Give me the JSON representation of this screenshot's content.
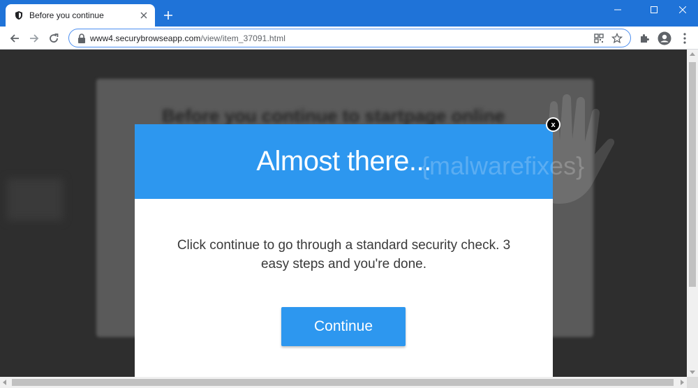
{
  "browser": {
    "tab_title": "Before you continue",
    "url_host": "www4.securybrowseapp.com",
    "url_path": "/view/item_37091.html",
    "icons": [
      "shield-icon",
      "close-icon",
      "plus-icon",
      "minimize-icon",
      "maximize-icon",
      "window-close-icon",
      "back-arrow-icon",
      "forward-arrow-icon",
      "reload-icon",
      "lock-icon",
      "qr-code-icon",
      "star-icon",
      "puzzle-icon",
      "profile-icon",
      "kebab-menu-icon"
    ],
    "accent_color": "#1f73d8"
  },
  "page": {
    "background_heading": "Before you continue to startpage online",
    "watermark": "{malwarefixes}",
    "modal": {
      "title": "Almost there...",
      "message": "Click continue to go through a standard security check. 3 easy steps and you're done.",
      "button_label": "Continue",
      "close_label": "x",
      "header_color": "#2d97ef"
    }
  }
}
